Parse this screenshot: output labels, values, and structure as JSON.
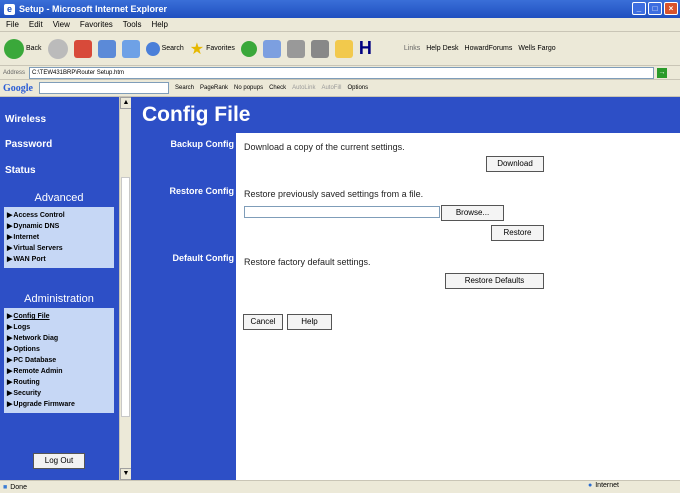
{
  "window": {
    "title": "Setup - Microsoft Internet Explorer"
  },
  "menu": [
    "File",
    "Edit",
    "View",
    "Favorites",
    "Tools",
    "Help"
  ],
  "toolbar": {
    "back_label": "Back",
    "search_label": "Search",
    "favorites_label": "Favorites",
    "links_label": "Links",
    "link1": "Help Desk",
    "link2": "HowardForums",
    "link3": "Wells Fargo"
  },
  "address": {
    "label": "Address",
    "value": "C:\\TEW431BRP\\Router Setup.htm"
  },
  "google": {
    "logo": "Google",
    "search_label": "Search",
    "pagerank": "PageRank",
    "popups": "No popups",
    "check": "Check",
    "autolink": "AutoLink",
    "autofill": "AutoFill",
    "options": "Options"
  },
  "sidebar": {
    "top_links": [
      "Wireless",
      "Password",
      "Status"
    ],
    "advanced": {
      "heading": "Advanced",
      "items": [
        "Access Control",
        "Dynamic DNS",
        "Internet",
        "Virtual Servers",
        "WAN Port"
      ]
    },
    "administration": {
      "heading": "Administration",
      "items": [
        "Config File",
        "Logs",
        "Network Diag",
        "Options",
        "PC Database",
        "Remote Admin",
        "Routing",
        "Security",
        "Upgrade Firmware"
      ]
    },
    "logout": "Log Out"
  },
  "page": {
    "title": "Config File",
    "backup": {
      "label": "Backup Config",
      "text": "Download a copy of the current settings.",
      "button": "Download"
    },
    "restore": {
      "label": "Restore Config",
      "text": "Restore previously saved settings from a file.",
      "browse": "Browse...",
      "button": "Restore"
    },
    "default": {
      "label": "Default Config",
      "text": "Restore factory default settings.",
      "button": "Restore Defaults"
    },
    "cancel": "Cancel",
    "help": "Help"
  },
  "status": {
    "left": "Done",
    "zone": "Internet"
  },
  "colors": {
    "accent": "#2d4fc6",
    "section_bg": "#c6d7f5"
  }
}
